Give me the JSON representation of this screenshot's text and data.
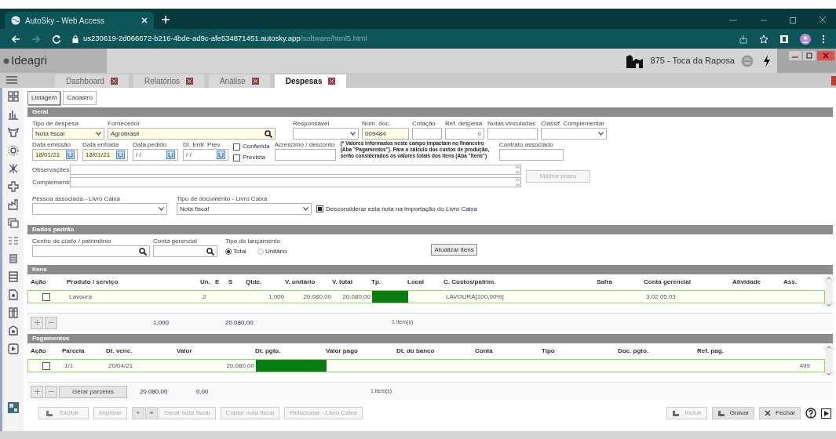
{
  "browser": {
    "tab_title": "AutoSky - Web Access",
    "url_host": "us230619-2d066672-b216-4bde-ad9c-afe534871451.autosky.app",
    "url_path": "/software/html5.html"
  },
  "app": {
    "logo": "Ideagri",
    "farm": "875 - Toca da Raposa"
  },
  "tabs": [
    {
      "label": "Dashboard",
      "selected": false
    },
    {
      "label": "Relatórios",
      "selected": false
    },
    {
      "label": "Análise",
      "selected": false
    },
    {
      "label": "Despesas",
      "selected": true
    }
  ],
  "subtabs": [
    {
      "label": "Listagem",
      "selected": false
    },
    {
      "label": "Cadastro",
      "selected": true
    }
  ],
  "geral": {
    "title": "Geral",
    "tipo_despesa": {
      "label": "Tipo de despesa",
      "value": "Nota fiscal"
    },
    "fornecedor": {
      "label": "Fornecedor",
      "value": "Agrobrasil"
    },
    "responsavel": {
      "label": "Responsável"
    },
    "num_doc": {
      "label": "Num. doc.",
      "value": "009484"
    },
    "cotacao": {
      "label": "Cotação"
    },
    "ref_despesa": {
      "label": "Ref. despesa",
      "value": "0"
    },
    "notas_vinculadas": {
      "label": "Notas vinculadas"
    },
    "classif": {
      "label": "Classif. Complementar"
    },
    "dates": [
      {
        "label": "Data emissão",
        "value": "18/01/21"
      },
      {
        "label": "Data entrada",
        "value": "18/01/21"
      },
      {
        "label": "Data pedido",
        "value": " / /"
      },
      {
        "label": "Dt. Entr. Prev.",
        "value": " / /"
      }
    ],
    "checks": [
      {
        "label": "Conferida",
        "checked": false
      },
      {
        "label": "Prevista",
        "checked": false
      }
    ],
    "acrescimo": {
      "label": "Acréscimo / desconto"
    },
    "note": "(* Valores informados neste campo impactam no financeiro (Aba \"Pagamentos\"). Para o cálculo dos custos de produção, serão considerados os valores totais dos itens (Aba \"Itens\")",
    "contrato": {
      "label": "Contrato associado"
    },
    "observacoes": {
      "label": "Observações"
    },
    "complemento": {
      "label": "Complemento"
    },
    "melhor_prazo": "Melhor prazo",
    "pessoa": {
      "label": "Pessoa associada - Livro Caixa"
    },
    "tipo_documento": {
      "label": "Tipo de documento - Livro Caixa",
      "value": "Nota fiscal"
    },
    "desconsiderar": {
      "label": "Desconsiderar esta nota na importação do Livro Caixa",
      "checked": true
    }
  },
  "dados": {
    "title": "Dados padrão",
    "centro": {
      "label": "Centro de custo / patrimônio"
    },
    "conta": {
      "label": "Conta gerencial"
    },
    "tipo_lancamento": {
      "label": "Tipo de lançamento",
      "options": [
        {
          "label": "Total",
          "selected": true
        },
        {
          "label": "Unitário",
          "selected": false
        }
      ]
    },
    "atualizar": "Atualizar itens"
  },
  "itens": {
    "title": "Itens",
    "columns": [
      "Ação",
      "Produto / serviço",
      "Un.",
      "E",
      "S",
      "Qtde.",
      "V. unitário",
      "V. total",
      "Tp.",
      "Local",
      "C. Custos/patrim.",
      "Safra",
      "Conta gerencial",
      "Atividade",
      "Ass."
    ],
    "rows": [
      {
        "checked": false,
        "cells": [
          "",
          "Lavoura",
          "2",
          "",
          "",
          "1,000",
          "20.080,00",
          "20.080,00",
          "",
          "",
          "LAVOURA[100,00%]",
          "",
          "3.02.05.03",
          "",
          ""
        ]
      }
    ],
    "totals": {
      "qtde": "1,000",
      "total": "20.080,00",
      "count": "1 item(s)"
    }
  },
  "pagamentos": {
    "title": "Pagamentos",
    "columns": [
      "Ação",
      "Parcela",
      "Dt. venc.",
      "Valor",
      "Dt. pgto.",
      "Valor pago",
      "Dt. do banco",
      "Conta",
      "Tipo",
      "Doc. pgto.",
      "Ref. pag."
    ],
    "rows": [
      {
        "checked": false,
        "cells": [
          "",
          "1/1",
          "20/04/21",
          "20.080,00",
          "",
          "",
          "",
          "",
          "",
          "",
          "499"
        ]
      }
    ],
    "gerar": "Gerar parcelas",
    "totals": {
      "valor": "20.080,00",
      "pago": "0,00",
      "count": "1 item(s)"
    }
  },
  "actions": [
    {
      "label": "Excluir",
      "disabled": true,
      "kind": "icon"
    },
    {
      "label": "Imprimir",
      "disabled": true,
      "kind": "plain"
    },
    {
      "label": "+",
      "disabled": false,
      "kind": "nav"
    },
    {
      "label": "»",
      "disabled": false,
      "kind": "nav"
    },
    {
      "label": "Gerar nota fiscal",
      "disabled": true,
      "kind": "plain"
    },
    {
      "label": "Copiar nota fiscal",
      "disabled": true,
      "kind": "plain"
    },
    {
      "label": "Relacionar - Livro Caixa",
      "disabled": true,
      "kind": "plain"
    }
  ],
  "right_actions": [
    {
      "label": "Incluir",
      "disabled": true
    },
    {
      "label": "Gravar",
      "disabled": false
    },
    {
      "label": "Fechar",
      "disabled": false
    }
  ]
}
